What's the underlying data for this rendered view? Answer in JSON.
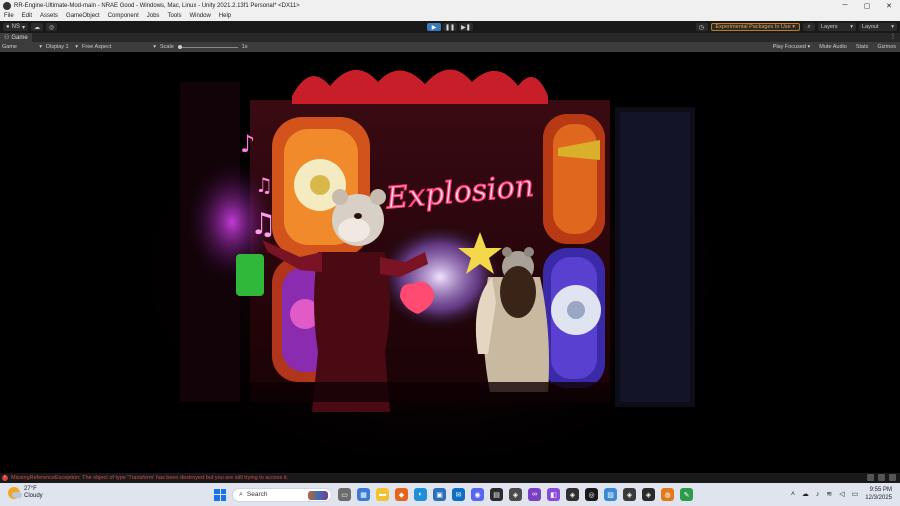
{
  "window": {
    "title": "RR-Engine-Ultimate-Mod-main - NRAE Good - Windows, Mac, Linux - Unity 2021.2.13f1 Personal* <DX11>",
    "controls": [
      "─",
      "▢",
      "✕"
    ]
  },
  "menu": [
    "File",
    "Edit",
    "Assets",
    "GameObject",
    "Component",
    "Jobs",
    "Tools",
    "Window",
    "Help"
  ],
  "toolbar": {
    "account": "NS",
    "experimental": "Experimental Packages In Use ▾",
    "layers": "Layers",
    "layout": "Layout"
  },
  "tab": {
    "label": "Game",
    "more": "⋮"
  },
  "gamebar": {
    "display_mode": "Game",
    "display": "Display 1",
    "aspect": "Free Aspect",
    "scale_label": "Scale",
    "scale_value": "1x",
    "scale_fraction": 0.0,
    "play_focused": "Play Focused",
    "mute_audio": "Mute Audio",
    "stats": "Stats",
    "gizmos": "Gizmos"
  },
  "scene": {
    "sign": "Explosion"
  },
  "status": {
    "error": "MissingReferenceException: The object of type 'Transform' has been destroyed but you are still trying to access it."
  },
  "taskbar": {
    "temperature": "27°F",
    "condition": "Cloudy",
    "search": "Search",
    "time": "9:55 PM",
    "date": "12/3/2025"
  }
}
